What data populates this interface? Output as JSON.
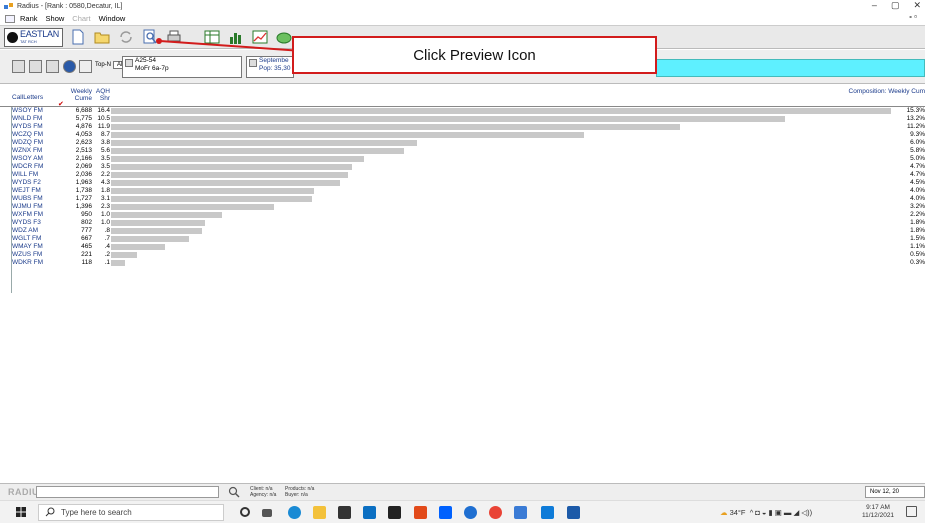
{
  "window": {
    "title": "Radius - [Rank : 0580,Decatur, IL]",
    "minimize": "–",
    "maximize": "▢",
    "close": "✕"
  },
  "menu": {
    "items": [
      "Rank",
      "Show",
      "Chart",
      "Window"
    ],
    "disabled": [
      false,
      false,
      true,
      false
    ],
    "right": "- ▫"
  },
  "toolbar": {
    "logo_text": "EASTLAN",
    "logo_sub": "TAT RCH"
  },
  "callout": {
    "text": "Click Preview Icon"
  },
  "filters": {
    "tope_label": "Top-N",
    "tope_value": "All",
    "demo_line1": "A25-54",
    "demo_line2": "MoFr 6a-7p",
    "period_line1": "Septembe",
    "period_line2": "Pop: 35,30"
  },
  "columns": {
    "callletters": "CallLetters",
    "cume": "Weekly Cume",
    "shr": "AQH Shr",
    "comp": "Composition: Weekly Cum"
  },
  "rows": [
    {
      "call": "WSOY FM",
      "cume": "6,688",
      "shr": "16.4",
      "value": 6688,
      "comp": "15.3%"
    },
    {
      "call": "WNLD FM",
      "cume": "5,775",
      "shr": "10.5",
      "value": 5775,
      "comp": "13.2%"
    },
    {
      "call": "WYDS FM",
      "cume": "4,876",
      "shr": "11.9",
      "value": 4876,
      "comp": "11.2%"
    },
    {
      "call": "WCZQ FM",
      "cume": "4,053",
      "shr": "8.7",
      "value": 4053,
      "comp": "9.3%"
    },
    {
      "call": "WDZQ FM",
      "cume": "2,623",
      "shr": "3.8",
      "value": 2623,
      "comp": "6.0%"
    },
    {
      "call": "WZNX FM",
      "cume": "2,513",
      "shr": "5.6",
      "value": 2513,
      "comp": "5.8%"
    },
    {
      "call": "WSOY AM",
      "cume": "2,166",
      "shr": "3.5",
      "value": 2166,
      "comp": "5.0%"
    },
    {
      "call": "WDCR FM",
      "cume": "2,069",
      "shr": "3.5",
      "value": 2069,
      "comp": "4.7%"
    },
    {
      "call": "WILL FM",
      "cume": "2,036",
      "shr": "2.2",
      "value": 2036,
      "comp": "4.7%"
    },
    {
      "call": "WYDS F2",
      "cume": "1,963",
      "shr": "4.3",
      "value": 1963,
      "comp": "4.5%"
    },
    {
      "call": "WEJT FM",
      "cume": "1,738",
      "shr": "1.8",
      "value": 1738,
      "comp": "4.0%"
    },
    {
      "call": "WUBS FM",
      "cume": "1,727",
      "shr": "3.1",
      "value": 1727,
      "comp": "4.0%"
    },
    {
      "call": "WJMU FM",
      "cume": "1,396",
      "shr": "2.3",
      "value": 1396,
      "comp": "3.2%"
    },
    {
      "call": "WXFM FM",
      "cume": "950",
      "shr": "1.0",
      "value": 950,
      "comp": "2.2%"
    },
    {
      "call": "WYDS F3",
      "cume": "802",
      "shr": "1.0",
      "value": 802,
      "comp": "1.8%"
    },
    {
      "call": "WDZ AM",
      "cume": "777",
      "shr": ".8",
      "value": 777,
      "comp": "1.8%"
    },
    {
      "call": "WGLT FM",
      "cume": "667",
      "shr": ".7",
      "value": 667,
      "comp": "1.5%"
    },
    {
      "call": "WMAY FM",
      "cume": "465",
      "shr": ".4",
      "value": 465,
      "comp": "1.1%"
    },
    {
      "call": "WZUS FM",
      "cume": "221",
      "shr": ".2",
      "value": 221,
      "comp": "0.5%"
    },
    {
      "call": "WDKR FM",
      "cume": "118",
      "shr": ".1",
      "value": 118,
      "comp": "0.3%"
    }
  ],
  "status": {
    "logo": "RADIUS",
    "client": "Client: n/a",
    "agency": "Agency: n/a",
    "products": "Products: n/a",
    "buyer": "Buyer: n/a",
    "date": "Nov 12, 20"
  },
  "taskbar": {
    "search_placeholder": "Type here to search",
    "weather": "34°F",
    "time": "9:17 AM",
    "date": "11/12/2021"
  }
}
